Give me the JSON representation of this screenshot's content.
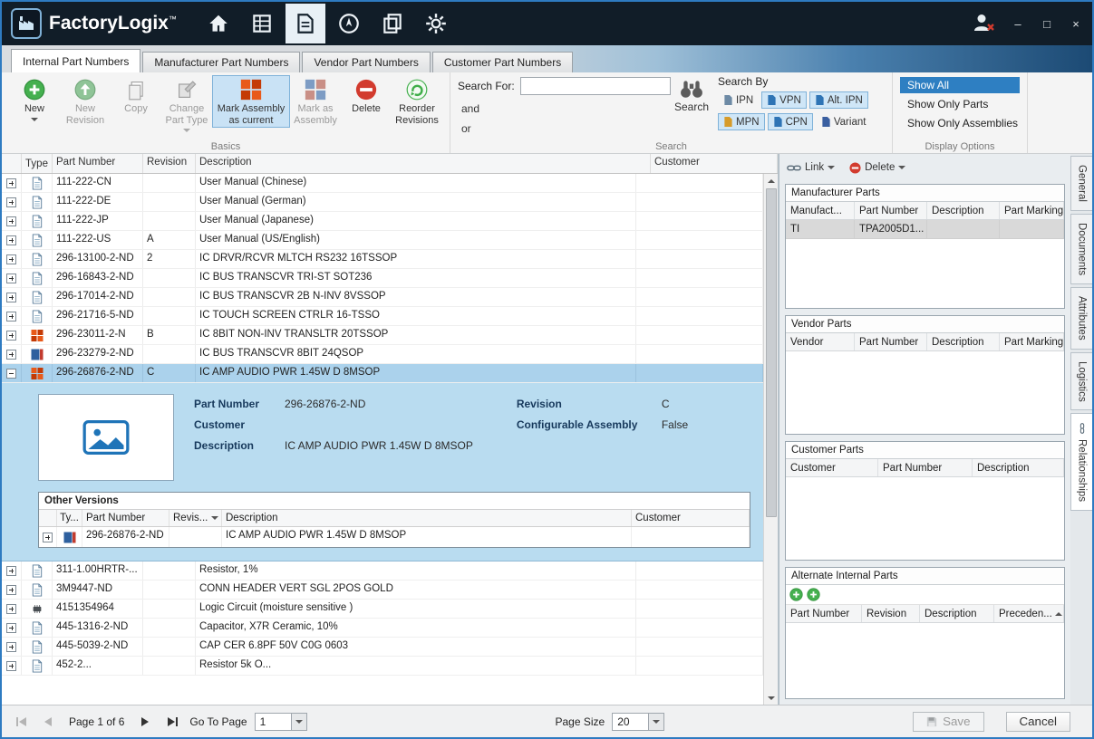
{
  "app": {
    "name": "FactoryLogix",
    "trademark": "™"
  },
  "window_controls": {
    "minimize": "–",
    "maximize": "□",
    "close": "×"
  },
  "tabs": [
    {
      "label": "Internal Part Numbers",
      "active": true
    },
    {
      "label": "Manufacturer Part Numbers",
      "active": false
    },
    {
      "label": "Vendor Part Numbers",
      "active": false
    },
    {
      "label": "Customer Part Numbers",
      "active": false
    }
  ],
  "ribbon": {
    "buttons": {
      "new": "New",
      "new_revision": "New Revision",
      "copy": "Copy",
      "change_part_type": "Change Part Type",
      "mark_assembly_current": "Mark Assembly as current",
      "mark_as_assembly": "Mark as Assembly",
      "delete": "Delete",
      "reorder_revisions": "Reorder Revisions"
    },
    "groups": {
      "basics": "Basics",
      "search": "Search",
      "display_options": "Display Options"
    },
    "search": {
      "search_for_label": "Search For:",
      "search_value": "",
      "and_label": "and",
      "or_label": "or",
      "search_button": "Search",
      "search_by_label": "Search By",
      "filters": [
        {
          "label": "IPN",
          "selected": false
        },
        {
          "label": "VPN",
          "selected": true
        },
        {
          "label": "Alt. IPN",
          "selected": true
        },
        {
          "label": "MPN",
          "selected": true
        },
        {
          "label": "CPN",
          "selected": true
        },
        {
          "label": "Variant",
          "selected": false
        }
      ]
    },
    "display": {
      "show_all": "Show All",
      "show_only_parts": "Show Only Parts",
      "show_only_assemblies": "Show Only Assemblies"
    }
  },
  "main_table": {
    "columns": {
      "type": "Type",
      "part_number": "Part Number",
      "revision": "Revision",
      "description": "Description",
      "customer": "Customer"
    },
    "rows": [
      {
        "type": "document",
        "part_number": "111-222-CN",
        "revision": "",
        "description": "User Manual (Chinese)",
        "customer": ""
      },
      {
        "type": "document",
        "part_number": "111-222-DE",
        "revision": "",
        "description": "User Manual (German)",
        "customer": ""
      },
      {
        "type": "document",
        "part_number": "111-222-JP",
        "revision": "",
        "description": "User Manual (Japanese)",
        "customer": ""
      },
      {
        "type": "document",
        "part_number": "111-222-US",
        "revision": "A",
        "description": "User Manual (US/English)",
        "customer": ""
      },
      {
        "type": "document",
        "part_number": "296-13100-2-ND",
        "revision": "2",
        "description": "IC DRVR/RCVR MLTCH RS232 16TSSOP",
        "customer": ""
      },
      {
        "type": "document",
        "part_number": "296-16843-2-ND",
        "revision": "",
        "description": "IC BUS TRANSCVR TRI-ST SOT236",
        "customer": ""
      },
      {
        "type": "document",
        "part_number": "296-17014-2-ND",
        "revision": "",
        "description": "IC BUS TRANSCVR 2B N-INV 8VSSOP",
        "customer": ""
      },
      {
        "type": "document",
        "part_number": "296-21716-5-ND",
        "revision": "",
        "description": "IC TOUCH SCREEN CTRLR 16-TSSO",
        "customer": ""
      },
      {
        "type": "assembly",
        "part_number": "296-23011-2-N",
        "revision": "B",
        "description": "IC 8BIT NON-INV TRANSLTR 20TSSOP",
        "customer": ""
      },
      {
        "type": "part",
        "part_number": "296-23279-2-ND",
        "revision": "",
        "description": "IC BUS TRANSCVR 8BIT 24QSOP",
        "customer": ""
      },
      {
        "type": "assembly",
        "part_number": "296-26876-2-ND",
        "revision": "C",
        "description": "IC AMP AUDIO PWR 1.45W D 8MSOP",
        "customer": "",
        "selected": true,
        "expanded": true
      },
      {
        "type": "document",
        "part_number": "311-1.00HRTR-...",
        "revision": "",
        "description": "Resistor, 1%",
        "customer": ""
      },
      {
        "type": "document",
        "part_number": "3M9447-ND",
        "revision": "",
        "description": "CONN HEADER VERT SGL 2POS GOLD",
        "customer": ""
      },
      {
        "type": "chip",
        "part_number": "4151354964",
        "revision": "",
        "description": "Logic Circuit (moisture sensitive )",
        "customer": ""
      },
      {
        "type": "document",
        "part_number": "445-1316-2-ND",
        "revision": "",
        "description": "Capacitor,  X7R Ceramic, 10%",
        "customer": ""
      },
      {
        "type": "document",
        "part_number": "445-5039-2-ND",
        "revision": "",
        "description": "CAP CER 6.8PF 50V C0G 0603",
        "customer": ""
      },
      {
        "type": "document",
        "part_number": "452-2...",
        "revision": "",
        "description": "Resistor 5k O...",
        "customer": ""
      }
    ]
  },
  "detail": {
    "fields": {
      "part_number_label": "Part Number",
      "part_number": "296-26876-2-ND",
      "customer_label": "Customer",
      "customer": "",
      "description_label": "Description",
      "description": "IC AMP AUDIO PWR 1.45W D 8MSOP",
      "revision_label": "Revision",
      "revision": "C",
      "configurable_assembly_label": "Configurable Assembly",
      "configurable_assembly": "False"
    },
    "other_versions": {
      "title": "Other Versions",
      "columns": {
        "type": "Ty...",
        "part_number": "Part Number",
        "revision": "Revis...",
        "description": "Description",
        "customer": "Customer"
      },
      "rows": [
        {
          "type": "part",
          "part_number": "296-26876-2-ND",
          "revision": "",
          "description": "IC AMP AUDIO PWR 1.45W D 8MSOP",
          "customer": ""
        }
      ]
    }
  },
  "relationships": {
    "toolbar": {
      "link": "Link",
      "delete": "Delete"
    },
    "manufacturer_parts": {
      "title": "Manufacturer Parts",
      "columns": [
        "Manufact...",
        "Part Number",
        "Description",
        "Part Marking"
      ],
      "rows": [
        {
          "manufacturer": "TI",
          "part_number": "TPA2005D1...",
          "description": "",
          "part_marking": ""
        }
      ]
    },
    "vendor_parts": {
      "title": "Vendor Parts",
      "columns": [
        "Vendor",
        "Part Number",
        "Description",
        "Part Marking"
      ],
      "rows": []
    },
    "customer_parts": {
      "title": "Customer Parts",
      "columns": [
        "Customer",
        "Part Number",
        "Description"
      ],
      "rows": []
    },
    "alternate_internal_parts": {
      "title": "Alternate Internal Parts",
      "columns": [
        "Part Number",
        "Revision",
        "Description",
        "Preceden..."
      ],
      "rows": []
    }
  },
  "side_tabs": [
    {
      "label": "General",
      "active": false
    },
    {
      "label": "Documents",
      "active": false
    },
    {
      "label": "Attributes",
      "active": false
    },
    {
      "label": "Logistics",
      "active": false
    },
    {
      "label": "Relationships",
      "active": true
    }
  ],
  "footer": {
    "page_text": "Page 1 of 6",
    "go_to_page_label": "Go To Page",
    "go_to_page_value": "1",
    "page_size_label": "Page Size",
    "page_size_value": "20",
    "save": "Save",
    "cancel": "Cancel"
  }
}
